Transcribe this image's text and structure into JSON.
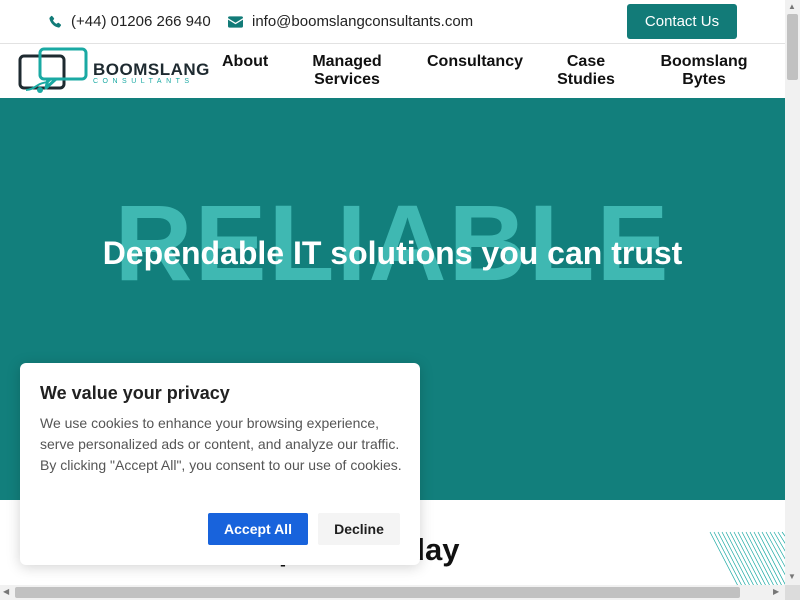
{
  "topbar": {
    "phone": "(+44) 01206 266 940",
    "email": "info@boomslangconsultants.com",
    "contact_button": "Contact Us"
  },
  "logo": {
    "name": "BOOMSLANG",
    "tagline": "CONSULTANTS"
  },
  "nav": {
    "about": "About",
    "managed_line1": "Managed",
    "managed_line2": "Services",
    "consultancy": "Consultancy",
    "case_line1": "Case",
    "case_line2": "Studies",
    "bytes_line1": "Boomslang",
    "bytes_line2": "Bytes"
  },
  "hero": {
    "background_word": "RELIABLE",
    "title": "Dependable IT solutions you can trust"
  },
  "lower": {
    "heading_visible": "lp You Today"
  },
  "cookie": {
    "title": "We value your privacy",
    "body": "We use cookies to enhance your browsing experience, serve personalized ads or content, and analyze our traffic. By clicking \"Accept All\", you consent to our use of cookies.",
    "accept": "Accept All",
    "decline": "Decline"
  },
  "colors": {
    "brand_teal": "#127f7c",
    "hero_text_ghost": "#3fb8b2",
    "accept_blue": "#1863dc"
  },
  "icons": {
    "phone": "phone-icon",
    "email": "envelope-icon"
  }
}
